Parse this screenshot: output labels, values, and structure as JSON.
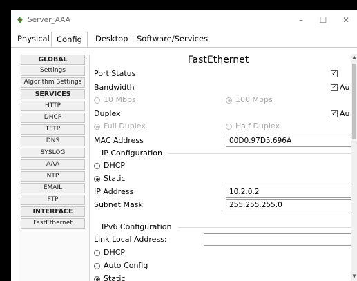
{
  "window": {
    "title": "Server_AAA",
    "minimize": "–",
    "maximize": "☐",
    "close": "✕"
  },
  "tabs": [
    "Physical",
    "Config",
    "Desktop",
    "Software/Services"
  ],
  "nav": {
    "items": [
      "GLOBAL",
      "Settings",
      "Algorithm Settings",
      "SERVICES",
      "HTTP",
      "DHCP",
      "TFTP",
      "DNS",
      "SYSLOG",
      "AAA",
      "NTP",
      "EMAIL",
      "FTP",
      "INTERFACE",
      "FastEthernet"
    ],
    "headers": [
      "GLOBAL",
      "SERVICES",
      "INTERFACE"
    ]
  },
  "panel": {
    "title": "FastEthernet",
    "port_status_label": "Port Status",
    "port_status_checked": true,
    "bandwidth_label": "Bandwidth",
    "bandwidth_auto_label": "Au",
    "bandwidth_10": "10 Mbps",
    "bandwidth_100": "100 Mbps",
    "duplex_label": "Duplex",
    "duplex_auto_label": "Au",
    "duplex_full": "Full Duplex",
    "duplex_half": "Half Duplex",
    "mac_label": "MAC Address",
    "mac_value": "00D0.97D5.696A",
    "ip_config_label": "IP Configuration",
    "dhcp": "DHCP",
    "static": "Static",
    "ip_label": "IP Address",
    "ip_value": "10.2.0.2",
    "mask_label": "Subnet Mask",
    "mask_value": "255.255.255.0",
    "ipv6_label": "IPv6 Configuration",
    "link_local_label": "Link Local Address:",
    "link_local_value": "",
    "dhcp6": "DHCP",
    "auto_config": "Auto Config",
    "static6": "Static"
  },
  "icons": {
    "app": "server-app-icon",
    "check": "✓"
  },
  "colors": {
    "accent_grey": "#c8c8c8"
  }
}
